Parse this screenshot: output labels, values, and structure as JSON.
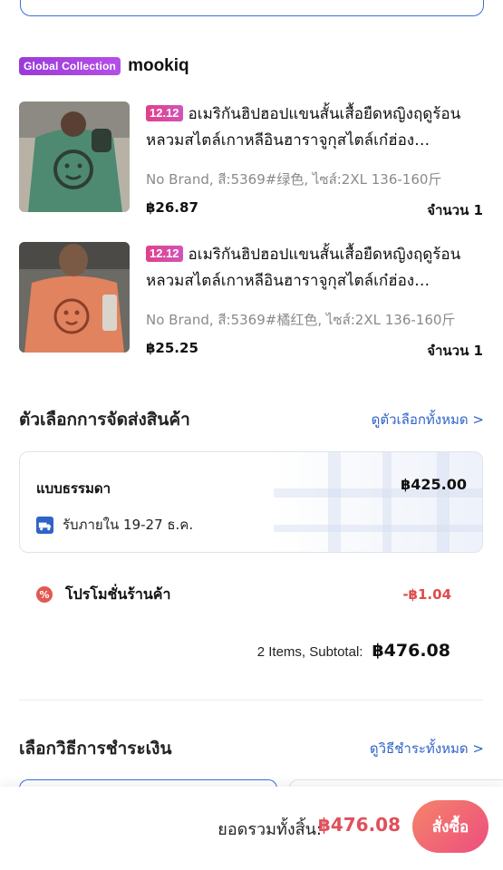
{
  "shop": {
    "badge": "Global Collection",
    "name": "mookiq"
  },
  "products": [
    {
      "promo_tag": "12.12",
      "title": "อเมริกันฮิปฮอปแขนสั้นเสื้อยืดหญิงฤดูร้อนหลวมสไตล์เกาหลีอินฮาราจูกุสไตล์เก๋ฮ่อง…",
      "variant": "No Brand, สี:5369#绿色, ไซส์:2XL 136-160斤",
      "price": "฿26.87",
      "qty": "จำนวน  1",
      "thumb_color": "#4e8a72"
    },
    {
      "promo_tag": "12.12",
      "title": "อเมริกันฮิปฮอปแขนสั้นเสื้อยืดหญิงฤดูร้อนหลวมสไตล์เกาหลีอินฮาราจูกุสไตล์เก๋ฮ่อง…",
      "variant": "No Brand, สี:5369#橘红色, ไซส์:2XL 136-160斤",
      "price": "฿25.25",
      "qty": "จำนวน  1",
      "thumb_color": "#e0835e"
    }
  ],
  "shipping": {
    "section_title": "ตัวเลือกการจัดส่งสินค้า",
    "view_all": "ดูตัวเลือกทั้งหมด >",
    "method": "แบบธรรมดา",
    "price": "฿425.00",
    "eta": "รับภายใน 19-27 ธ.ค."
  },
  "promotion": {
    "icon": "%",
    "label": "โปรโมชั่นร้านค้า",
    "value": "-฿1.04"
  },
  "subtotal": {
    "label": "2 Items, Subtotal:",
    "value": "฿476.08"
  },
  "payment": {
    "section_title": "เลือกวิธีการชำระเงิน",
    "view_all": "ดูวิธีชำระทั้งหมด >"
  },
  "footer": {
    "total_label": "ยอดรวมทั้งสิ้น:",
    "total_value": "฿476.08",
    "order_button": "สั่งซื้อ"
  },
  "colors": {
    "accent_blue": "#2f63c8",
    "price_red": "#e0505a",
    "badge_purple": "#9a3bd9",
    "promo_pink": "#e0408a"
  }
}
